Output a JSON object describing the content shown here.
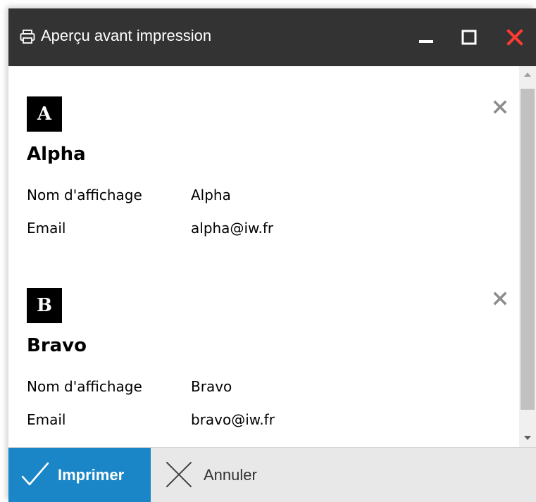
{
  "window": {
    "title": "Aperçu avant impression",
    "icon": "printer-icon",
    "controls": [
      "minimize-icon",
      "maximize-icon",
      "close-icon"
    ],
    "close_color": "#ff3b30",
    "titlebar_color": "#333333"
  },
  "contacts": [
    {
      "letter": "A",
      "name": "Alpha",
      "fields": [
        {
          "label": "Nom d'affichage",
          "value": "Alpha"
        },
        {
          "label": "Email",
          "value": "alpha@iw.fr"
        }
      ]
    },
    {
      "letter": "B",
      "name": "Bravo",
      "fields": [
        {
          "label": "Nom d'affichage",
          "value": "Bravo"
        },
        {
          "label": "Email",
          "value": "bravo@iw.fr"
        }
      ]
    }
  ],
  "footer": {
    "print_label": "Imprimer",
    "print_icon": "checkmark-icon",
    "cancel_label": "Annuler",
    "cancel_icon": "x-icon",
    "accent": "#1a86c7"
  }
}
